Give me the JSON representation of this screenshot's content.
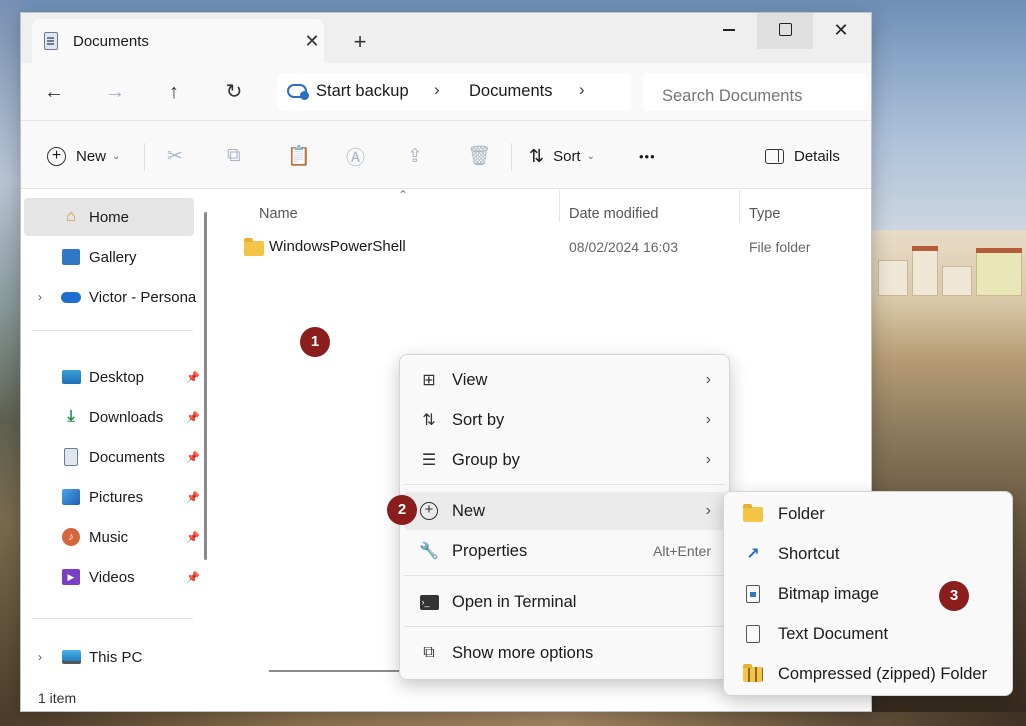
{
  "window": {
    "tab_title": "Documents",
    "tab_close": "✕",
    "new_tab": "+"
  },
  "nav": {
    "back": "←",
    "forward": "→",
    "up": "↑",
    "refresh": "↻",
    "breadcrumbs": [
      "Start backup",
      "Documents"
    ],
    "search_placeholder": "Search Documents"
  },
  "commands": {
    "new_label": "New",
    "sort_label": "Sort",
    "more_label": "•••",
    "details_label": "Details"
  },
  "sidebar": {
    "items": [
      {
        "label": "Home"
      },
      {
        "label": "Gallery"
      },
      {
        "label": "Victor - Persona"
      },
      {
        "label": "Desktop"
      },
      {
        "label": "Downloads"
      },
      {
        "label": "Documents"
      },
      {
        "label": "Pictures"
      },
      {
        "label": "Music"
      },
      {
        "label": "Videos"
      },
      {
        "label": "This PC"
      }
    ]
  },
  "file_list": {
    "columns": [
      "Name",
      "Date modified",
      "Type"
    ],
    "rows": [
      {
        "name": "WindowsPowerShell",
        "date": "08/02/2024 16:03",
        "type": "File folder"
      }
    ]
  },
  "status": {
    "count": "1 item"
  },
  "badges": [
    "1",
    "2",
    "3"
  ],
  "context_menu": {
    "items": [
      {
        "label": "View"
      },
      {
        "label": "Sort by"
      },
      {
        "label": "Group by"
      },
      {
        "label": "New"
      },
      {
        "label": "Properties",
        "shortcut": "Alt+Enter"
      },
      {
        "label": "Open in Terminal"
      },
      {
        "label": "Show more options"
      }
    ]
  },
  "new_submenu": {
    "items": [
      {
        "label": "Folder"
      },
      {
        "label": "Shortcut"
      },
      {
        "label": "Bitmap image"
      },
      {
        "label": "Text Document"
      },
      {
        "label": "Compressed (zipped) Folder"
      }
    ]
  }
}
